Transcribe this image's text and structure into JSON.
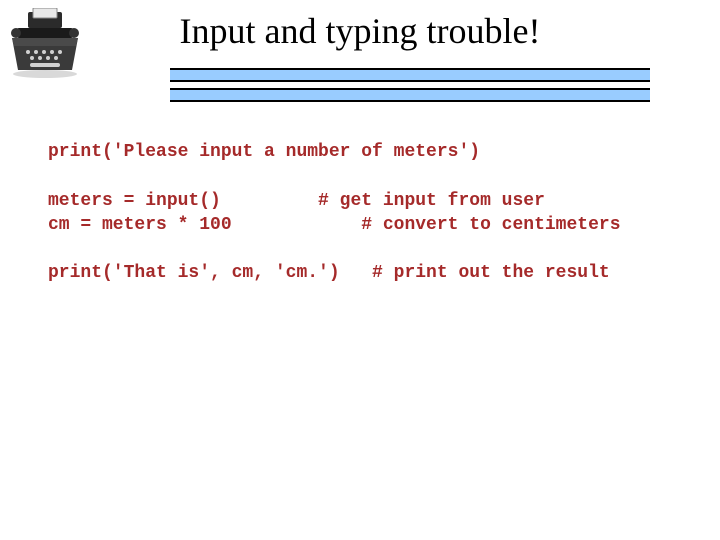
{
  "title": "Input and typing trouble!",
  "code": {
    "line1": "print('Please input a number of meters')",
    "blank1": "",
    "line2": "meters = input()         # get input from user",
    "line3": "cm = meters * 100            # convert to centimeters",
    "blank2": "",
    "line4": "print('That is', cm, 'cm.')   # print out the result"
  }
}
